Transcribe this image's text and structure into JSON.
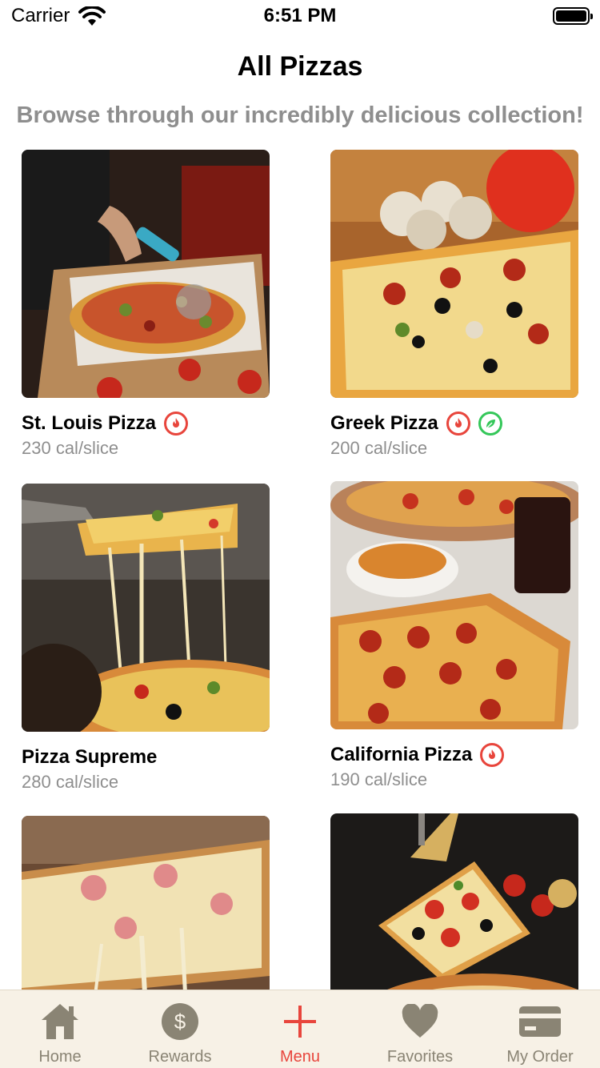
{
  "status_bar": {
    "carrier": "Carrier",
    "time": "6:51 PM"
  },
  "header": {
    "title": "All Pizzas",
    "subtitle": "Browse through our incredibly delicious collection!"
  },
  "pizzas": [
    {
      "name": "St. Louis Pizza",
      "calories": "230 cal/slice",
      "badges": [
        "flame-icon"
      ]
    },
    {
      "name": "Greek Pizza",
      "calories": "200 cal/slice",
      "badges": [
        "flame-icon",
        "leaf-icon"
      ]
    },
    {
      "name": "Pizza Supreme",
      "calories": "280 cal/slice",
      "badges": []
    },
    {
      "name": "California Pizza",
      "calories": "190 cal/slice",
      "badges": [
        "flame-icon"
      ]
    },
    {
      "name": "",
      "calories": "",
      "badges": []
    },
    {
      "name": "",
      "calories": "",
      "badges": []
    }
  ],
  "tab_bar": {
    "items": [
      {
        "label": "Home",
        "icon": "house-icon",
        "active": false
      },
      {
        "label": "Rewards",
        "icon": "dollar-icon",
        "active": false
      },
      {
        "label": "Menu",
        "icon": "plus-icon",
        "active": true
      },
      {
        "label": "Favorites",
        "icon": "heart-icon",
        "active": false
      },
      {
        "label": "My Order",
        "icon": "credit-card-icon",
        "active": false
      }
    ]
  },
  "colors": {
    "accent": "#e8453c",
    "veg": "#34c759",
    "secondary_text": "#8e8e8e",
    "tab_bar_background": "#f7f1e6",
    "tab_inactive": "#8a8474"
  }
}
